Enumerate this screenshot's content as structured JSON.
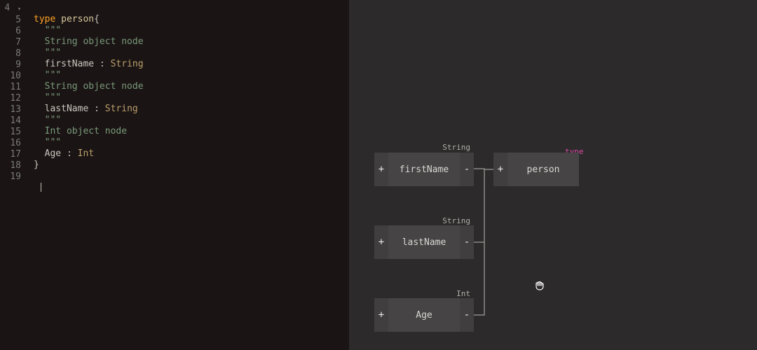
{
  "editor": {
    "lines": [
      {
        "num": "4",
        "fold": true
      },
      {
        "num": "5"
      },
      {
        "num": "6"
      },
      {
        "num": "7"
      },
      {
        "num": "8"
      },
      {
        "num": "9"
      },
      {
        "num": "10"
      },
      {
        "num": "11"
      },
      {
        "num": "12"
      },
      {
        "num": "13"
      },
      {
        "num": "14"
      },
      {
        "num": "15"
      },
      {
        "num": "16"
      },
      {
        "num": "17"
      },
      {
        "num": "18"
      },
      {
        "num": "19"
      }
    ],
    "tok": {
      "type_kw": "type",
      "person": "person",
      "brace_open": "{",
      "brace_close": "}",
      "triple_quote": "\"\"\"",
      "string_desc": "String object node",
      "int_desc": "Int object node",
      "firstName": "firstName",
      "lastName": "lastName",
      "age": "Age",
      "colon": " : ",
      "String": "String",
      "Int": "Int"
    }
  },
  "canvas": {
    "nodes": {
      "firstName": {
        "label": "firstName",
        "datatype": "String",
        "plus": "+",
        "minus": "-"
      },
      "lastName": {
        "label": "lastName",
        "datatype": "String",
        "plus": "+",
        "minus": "-"
      },
      "age": {
        "label": "Age",
        "datatype": "Int",
        "plus": "+",
        "minus": "-"
      },
      "person": {
        "label": "person",
        "tag": "type",
        "plus": "+"
      }
    }
  }
}
